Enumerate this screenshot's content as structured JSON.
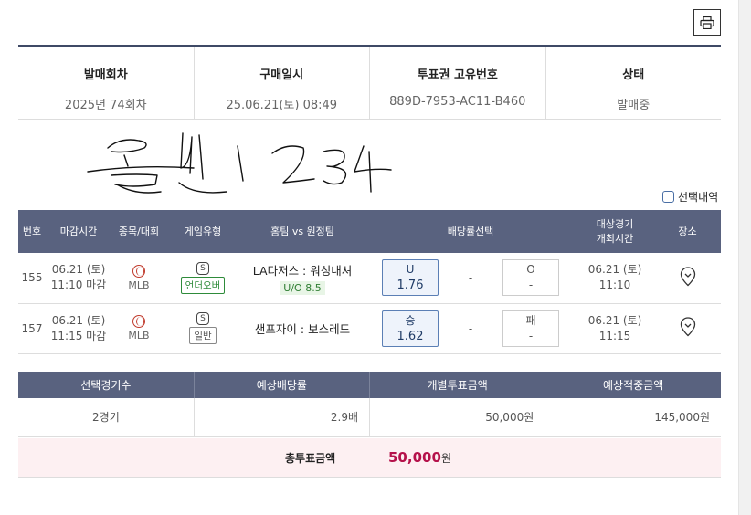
{
  "info": [
    {
      "label": "발매회차",
      "value": "2025년 74회차"
    },
    {
      "label": "구매일시",
      "value": "25.06.21(토) 08:49"
    },
    {
      "label": "투표권 고유번호",
      "value": "889D-7953-AC11-B460"
    },
    {
      "label": "상태",
      "value": "발매중"
    }
  ],
  "signature_text": "물빈1234",
  "select_label": "선택내역",
  "headers": {
    "no": "번호",
    "deadline": "마감시간",
    "sport": "종목/대회",
    "type": "게임유형",
    "teams": "홈팀 vs 원정팀",
    "odds": "배당률선택",
    "game_time_1": "대상경기",
    "game_time_2": "개최시간",
    "venue": "장소"
  },
  "games": [
    {
      "no": "155",
      "deadline_date": "06.21 (토)",
      "deadline_time": "11:10 마감",
      "sport": "MLB",
      "type_icon": "S",
      "type": "언더오버",
      "type_color": "#2e8b3a",
      "teams": "LA다저스 : 워싱내셔",
      "sub": "U/O 8.5",
      "pick_label": "U",
      "pick_odds": "1.76",
      "mid": "-",
      "opp_label": "O",
      "opp_odds": "-",
      "game_date": "06.21 (토)",
      "game_time": "11:10",
      "venue_icon": "map-pin-icon"
    },
    {
      "no": "157",
      "deadline_date": "06.21 (토)",
      "deadline_time": "11:15 마감",
      "sport": "MLB",
      "type_icon": "S",
      "type": "일반",
      "type_color": "#888888",
      "teams": "샌프자이 : 보스레드",
      "sub": "",
      "pick_label": "승",
      "pick_odds": "1.62",
      "mid": "-",
      "opp_label": "패",
      "opp_odds": "-",
      "game_date": "06.21 (토)",
      "game_time": "11:15",
      "venue_icon": "map-pin-icon"
    }
  ],
  "summary": {
    "headers": [
      "선택경기수",
      "예상배당률",
      "개별투표금액",
      "예상적중금액"
    ],
    "values": [
      "2경기",
      "2.9배",
      "50,000원",
      "145,000원"
    ]
  },
  "total": {
    "label": "총투표금액",
    "amount": "50,000",
    "unit": "원"
  },
  "colors": {
    "header_bg": "#59627f",
    "accent_red": "#b5124b",
    "pick_border": "#5b7fb5"
  }
}
